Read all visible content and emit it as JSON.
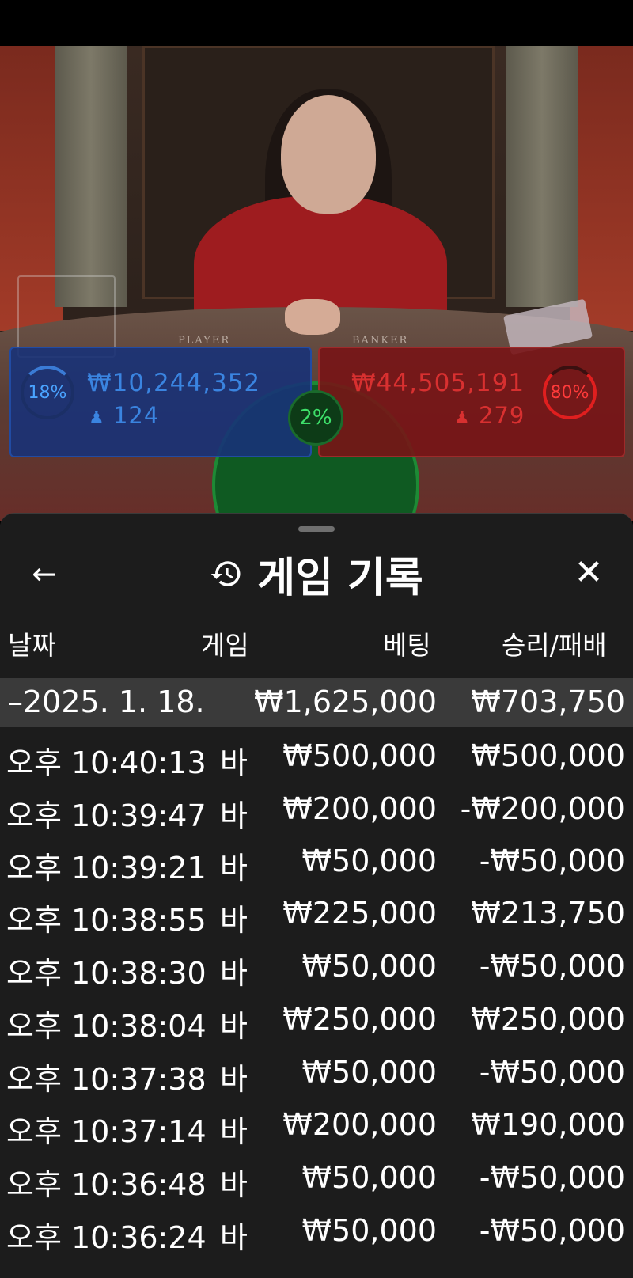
{
  "live": {
    "table_labels": {
      "player": "PLAYER",
      "banker": "BANKER"
    },
    "player": {
      "percent": "18%",
      "amount": "₩10,244,352",
      "count": "124",
      "color": "#4aa3ff"
    },
    "banker": {
      "percent": "80%",
      "amount": "₩44,505,191",
      "count": "279",
      "color": "#ff3a3a"
    },
    "tie": {
      "percent": "2%",
      "color": "#3ee06a"
    }
  },
  "sheet": {
    "title": "게임 기록",
    "back_icon": "back-arrow-icon",
    "history_icon": "history-icon",
    "close_icon": "close-icon",
    "columns": {
      "date": "날짜",
      "game": "게임",
      "bet": "베팅",
      "winloss": "승리/패배"
    },
    "day_summary": {
      "date": "–2025. 1. 18.",
      "bet": "₩1,625,000",
      "winloss": "₩703,750"
    },
    "rows": [
      {
        "time": "오후 10:40:13",
        "game": "바",
        "bet": "₩500,000",
        "winloss": "₩500,000"
      },
      {
        "time": "오후 10:39:47",
        "game": "바",
        "bet": "₩200,000",
        "winloss": "-₩200,000"
      },
      {
        "time": "오후 10:39:21",
        "game": "바",
        "bet": "₩50,000",
        "winloss": "-₩50,000"
      },
      {
        "time": "오후 10:38:55",
        "game": "바",
        "bet": "₩225,000",
        "winloss": "₩213,750"
      },
      {
        "time": "오후 10:38:30",
        "game": "바",
        "bet": "₩50,000",
        "winloss": "-₩50,000"
      },
      {
        "time": "오후 10:38:04",
        "game": "바",
        "bet": "₩250,000",
        "winloss": "₩250,000"
      },
      {
        "time": "오후 10:37:38",
        "game": "바",
        "bet": "₩50,000",
        "winloss": "-₩50,000"
      },
      {
        "time": "오후 10:37:14",
        "game": "바",
        "bet": "₩200,000",
        "winloss": "₩190,000"
      },
      {
        "time": "오후 10:36:48",
        "game": "바",
        "bet": "₩50,000",
        "winloss": "-₩50,000"
      },
      {
        "time": "오후 10:36:24",
        "game": "바",
        "bet": "₩50,000",
        "winloss": "-₩50,000"
      }
    ]
  }
}
